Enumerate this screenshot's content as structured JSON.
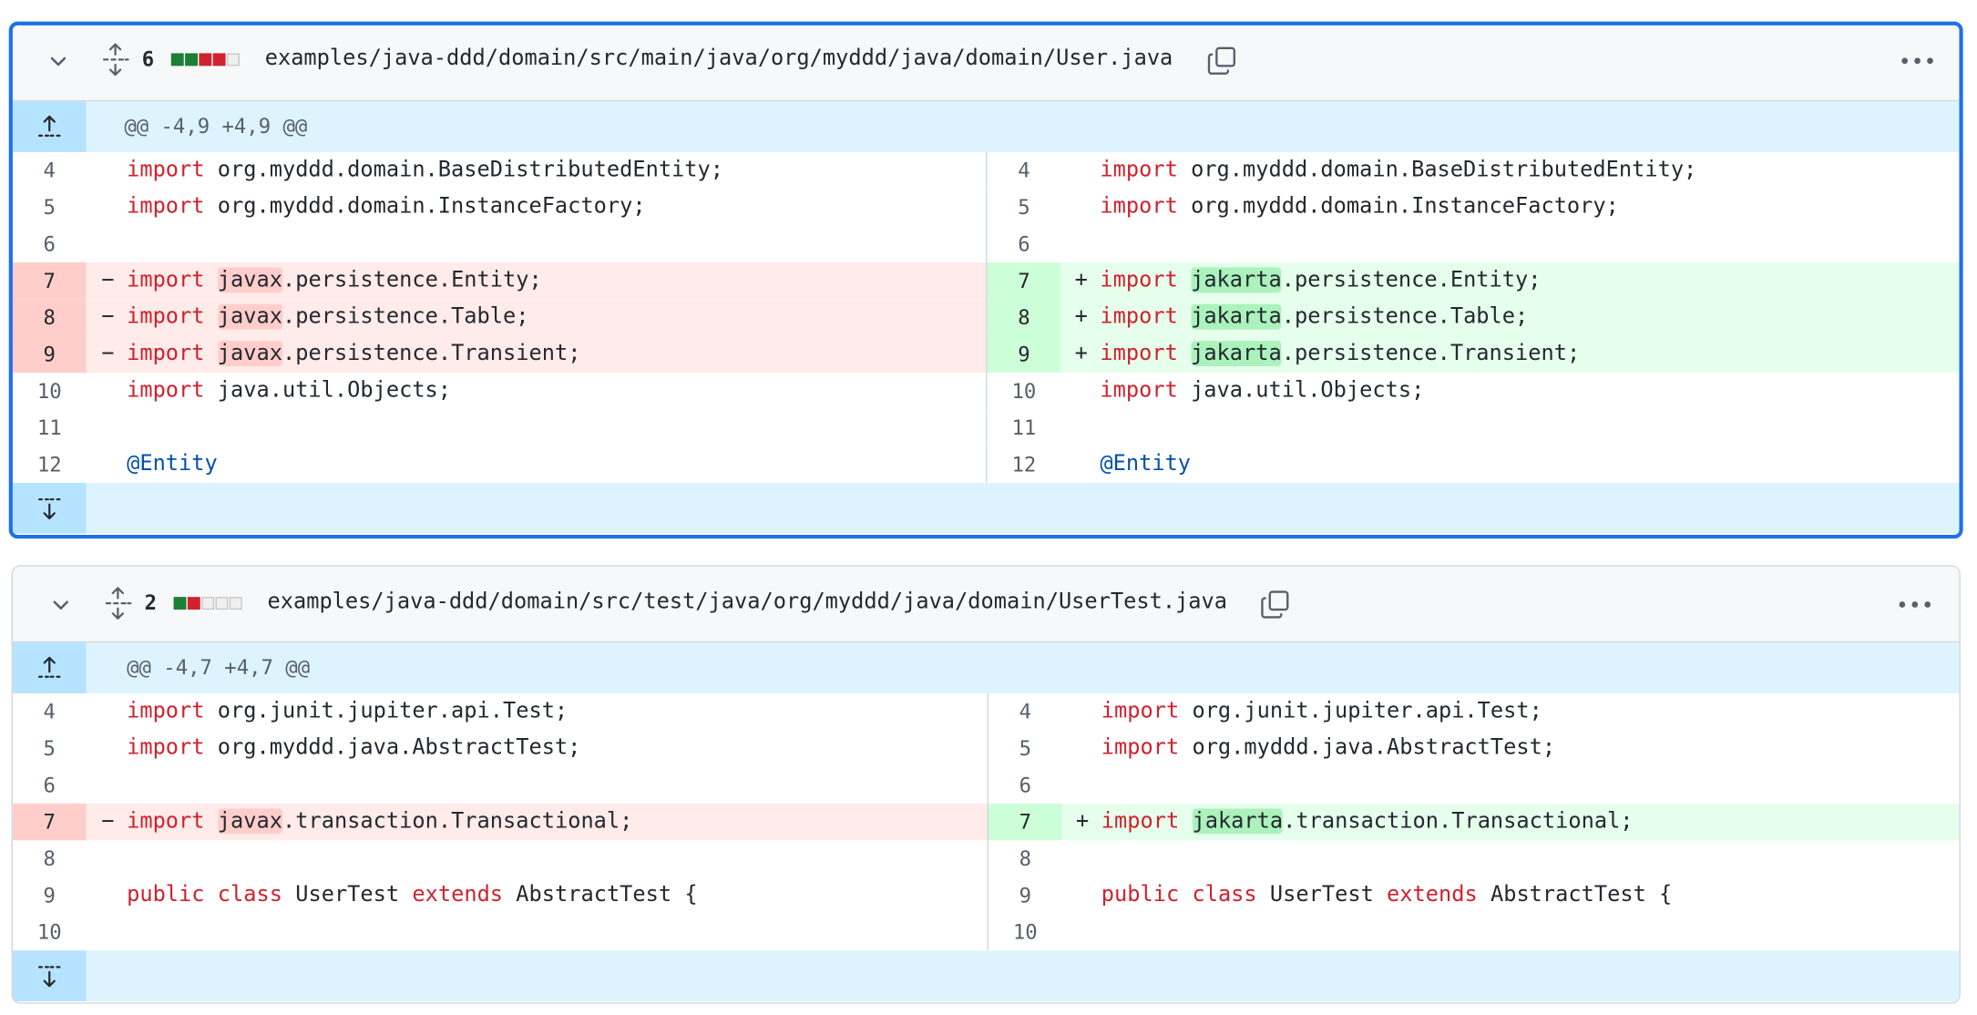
{
  "files": [
    {
      "change_count": "6",
      "diffstat": [
        "add",
        "add",
        "del",
        "del",
        "neutral"
      ],
      "path": "examples/java-ddd/domain/src/main/java/org/myddd/java/domain/User.java",
      "hunk_header": "@@ -4,9 +4,9 @@",
      "lines": [
        {
          "type": "ctx",
          "num": "4",
          "kw": "import",
          "rest": " org.myddd.domain.BaseDistributedEntity;"
        },
        {
          "type": "ctx",
          "num": "5",
          "kw": "import",
          "rest": " org.myddd.domain.InstanceFactory;"
        },
        {
          "type": "ctx",
          "num": "6",
          "kw": "",
          "rest": ""
        },
        {
          "type": "chg",
          "num": "7",
          "kw": "import",
          "old_word": "javax",
          "new_word": "jakarta",
          "rest": ".persistence.Entity;"
        },
        {
          "type": "chg",
          "num": "8",
          "kw": "import",
          "old_word": "javax",
          "new_word": "jakarta",
          "rest": ".persistence.Table;"
        },
        {
          "type": "chg",
          "num": "9",
          "kw": "import",
          "old_word": "javax",
          "new_word": "jakarta",
          "rest": ".persistence.Transient;"
        },
        {
          "type": "ctx",
          "num": "10",
          "kw": "import",
          "rest": " java.util.Objects;"
        },
        {
          "type": "ctx",
          "num": "11",
          "kw": "",
          "rest": ""
        },
        {
          "type": "ann",
          "num": "12",
          "text": "@Entity"
        }
      ]
    },
    {
      "change_count": "2",
      "diffstat": [
        "add",
        "del",
        "neutral",
        "neutral",
        "neutral"
      ],
      "path": "examples/java-ddd/domain/src/test/java/org/myddd/java/domain/UserTest.java",
      "hunk_header": "@@ -4,7 +4,7 @@",
      "lines": [
        {
          "type": "ctx",
          "num": "4",
          "kw": "import",
          "rest": " org.junit.jupiter.api.Test;"
        },
        {
          "type": "ctx",
          "num": "5",
          "kw": "import",
          "rest": " org.myddd.java.AbstractTest;"
        },
        {
          "type": "ctx",
          "num": "6",
          "kw": "",
          "rest": ""
        },
        {
          "type": "chg",
          "num": "7",
          "kw": "import",
          "old_word": "javax",
          "new_word": "jakarta",
          "rest": ".transaction.Transactional;"
        },
        {
          "type": "ctx",
          "num": "8",
          "kw": "",
          "rest": ""
        },
        {
          "type": "cls",
          "num": "9",
          "kw1": "public",
          "kw2": "class",
          "name": "UserTest",
          "kw3": "extends",
          "rest": "AbstractTest {"
        },
        {
          "type": "ctx",
          "num": "10",
          "kw": "",
          "rest": ""
        }
      ]
    }
  ],
  "markers": {
    "del": "−",
    "add": "+"
  },
  "colors": {
    "accent": "#1f6feb",
    "add": "#1a7f37",
    "del": "#cf222e",
    "hunk_bg": "#ddf4ff"
  }
}
